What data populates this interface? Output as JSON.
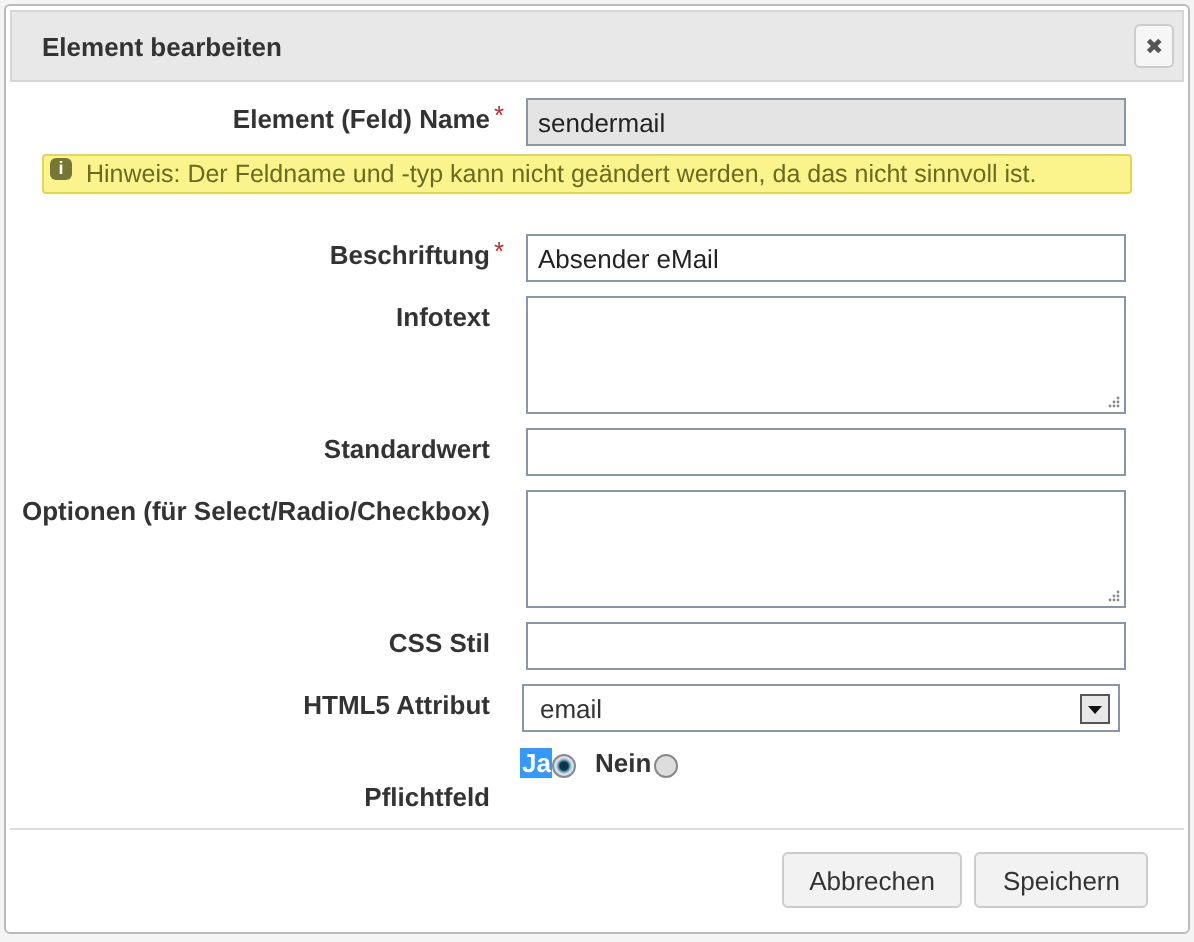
{
  "dialog": {
    "title": "Element bearbeiten",
    "close": "✖"
  },
  "fields": [
    {
      "kind": "text",
      "label": "Element (Feld) Name",
      "required_mark": "*",
      "value": "sendermail",
      "disabled": true,
      "hint": {
        "icon": "i",
        "text": "Hinweis: Der Feldname und -typ kann nicht geändert werden, da das nicht sinnvoll ist."
      }
    },
    {
      "kind": "text",
      "label": "Beschriftung",
      "required_mark": "*",
      "value": "Absender eMail",
      "disabled": false
    },
    {
      "kind": "textarea",
      "label": "Infotext"
    },
    {
      "kind": "text",
      "label": "Standardwert",
      "disabled": false
    },
    {
      "kind": "textarea",
      "label": "Optionen (für Select/Radio/Checkbox)"
    },
    {
      "kind": "text",
      "label": "CSS Stil",
      "disabled": false
    },
    {
      "kind": "select",
      "label": "HTML5 Attribut",
      "value": "email"
    },
    {
      "kind": "radio",
      "label": "Pflichtfeld",
      "options": [
        {
          "label": "Ja",
          "selected": true,
          "highlighted": true
        },
        {
          "label": "Nein",
          "selected": false,
          "highlighted": false
        }
      ]
    }
  ],
  "buttons": [
    "Abbrechen",
    "Speichern"
  ]
}
